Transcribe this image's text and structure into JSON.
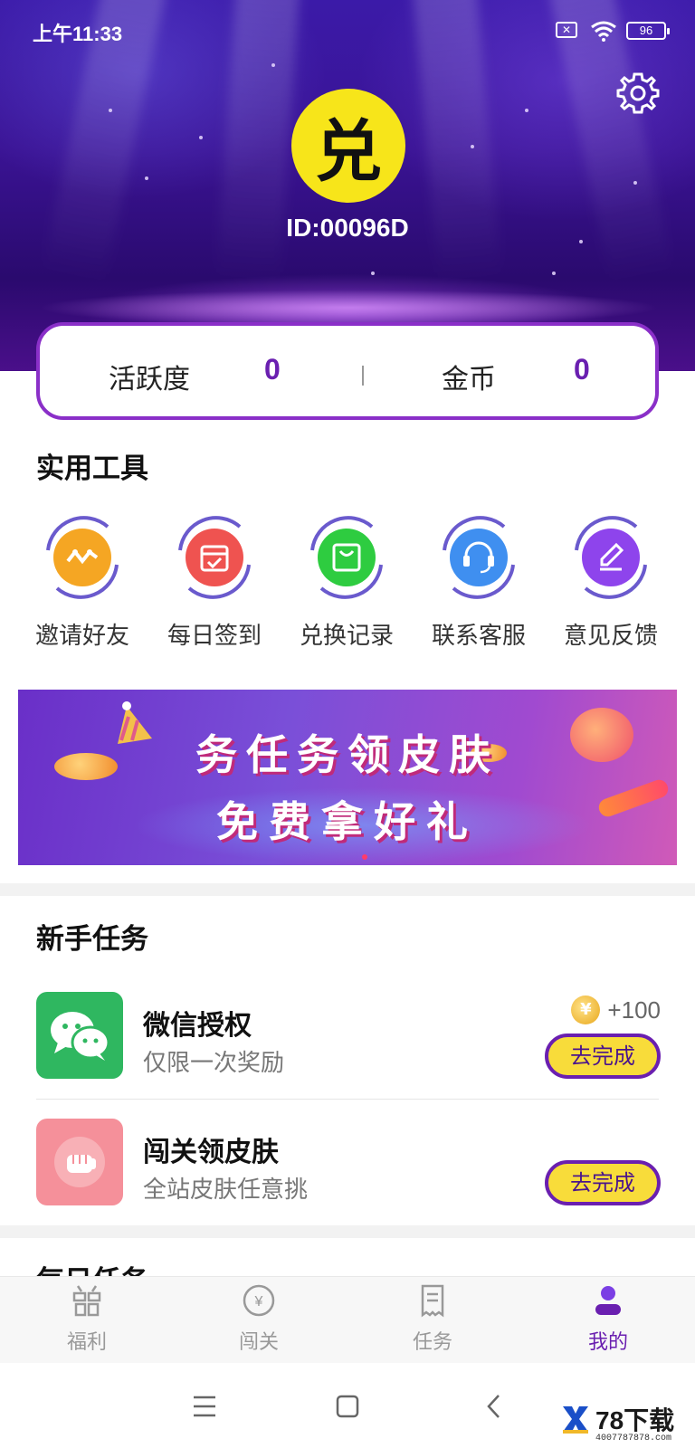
{
  "status_bar": {
    "time": "上午11:33",
    "battery": "96",
    "sim_icon": "sim-disabled-icon",
    "wifi_icon": "wifi-icon"
  },
  "header": {
    "avatar_glyph": "兑",
    "user_id": "ID:00096D",
    "settings_icon": "gear-icon"
  },
  "stats": {
    "activity_label": "活跃度",
    "activity_value": "0",
    "coins_label": "金币",
    "coins_value": "0"
  },
  "tools": {
    "title": "实用工具",
    "items": [
      {
        "label": "邀请好友",
        "icon": "invite-icon",
        "color": "#f5a623"
      },
      {
        "label": "每日签到",
        "icon": "calendar-check-icon",
        "color": "#ef5350"
      },
      {
        "label": "兑换记录",
        "icon": "shopping-bag-icon",
        "color": "#2ecc40"
      },
      {
        "label": "联系客服",
        "icon": "headset-icon",
        "color": "#3f8ff0"
      },
      {
        "label": "意见反馈",
        "icon": "pencil-icon",
        "color": "#8e44ec"
      }
    ]
  },
  "banner": {
    "line1": "务任务领皮肤",
    "line2": "免费拿好礼"
  },
  "newbie_tasks": {
    "title": "新手任务",
    "items": [
      {
        "title": "微信授权",
        "subtitle": "仅限一次奖励",
        "reward": "+100",
        "button": "去完成",
        "icon": "wechat-icon",
        "icon_bg": "#2fb760"
      },
      {
        "title": "闯关领皮肤",
        "subtitle": "全站皮肤任意挑",
        "button": "去完成",
        "icon": "fist-icon",
        "icon_bg": "#f5909a"
      }
    ]
  },
  "daily_tasks": {
    "title": "每日任务"
  },
  "tabbar": {
    "items": [
      {
        "label": "福利",
        "icon": "gift-icon"
      },
      {
        "label": "闯关",
        "icon": "yen-coin-icon"
      },
      {
        "label": "任务",
        "icon": "receipt-icon"
      },
      {
        "label": "我的",
        "icon": "user-icon",
        "active": true
      }
    ]
  },
  "watermark": {
    "brand": "78下载",
    "site": "4007787878.com"
  },
  "colors": {
    "accent": "#6a1fb0",
    "button_fill": "#f8dc3a",
    "header_bg": "#3a1394"
  }
}
